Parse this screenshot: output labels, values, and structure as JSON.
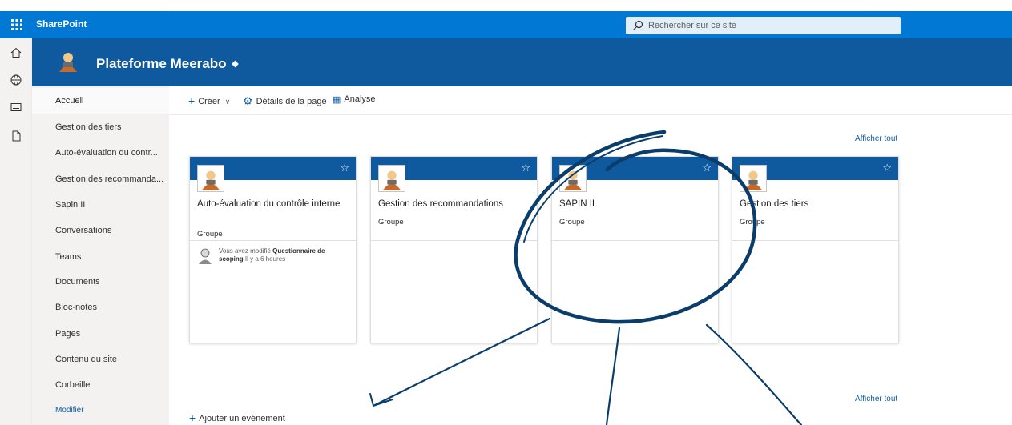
{
  "suite": {
    "brand": "SharePoint",
    "search_placeholder": "Rechercher sur ce site"
  },
  "site": {
    "title": "Plateforme Meerabo"
  },
  "nav": {
    "items": [
      {
        "label": "Accueil"
      },
      {
        "label": "Gestion des tiers"
      },
      {
        "label": "Auto-évaluation du contr..."
      },
      {
        "label": "Gestion des recommanda..."
      },
      {
        "label": "Sapin II"
      },
      {
        "label": "Conversations"
      },
      {
        "label": "Teams"
      },
      {
        "label": "Documents"
      },
      {
        "label": "Bloc-notes"
      },
      {
        "label": "Pages"
      },
      {
        "label": "Contenu du site"
      },
      {
        "label": "Corbeille"
      }
    ],
    "edit_label": "Modifier"
  },
  "commands": {
    "create": "Créer",
    "page_details": "Détails de la page",
    "analytics": "Analyse"
  },
  "sites_section": {
    "show_all": "Afficher tout"
  },
  "cards": [
    {
      "title": "Auto-évaluation du contrôle interne",
      "type": "Groupe",
      "activity_prefix": "Vous avez modifié ",
      "activity_doc": "Questionnaire de scoping",
      "activity_time": " Il y a 6 heures"
    },
    {
      "title": "Gestion des recommandations",
      "type": "Groupe"
    },
    {
      "title": "SAPIN II",
      "type": "Groupe"
    },
    {
      "title": "Gestion des tiers",
      "type": "Groupe"
    }
  ],
  "events_section": {
    "show_all": "Afficher tout",
    "add_event": "Ajouter un événement"
  },
  "colors": {
    "suite_bar": "#0078d4",
    "site_header": "#0f5a9e",
    "annotation": "#0b3d6b"
  }
}
